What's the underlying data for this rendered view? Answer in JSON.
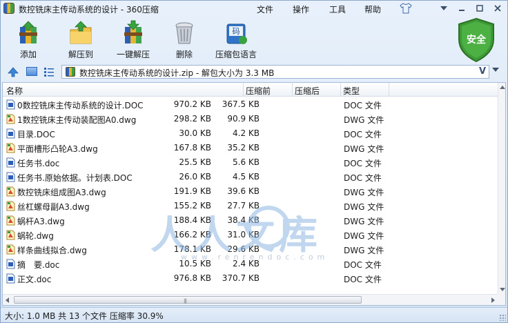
{
  "window": {
    "title": "数控铣床主传动系统的设计 - 360压缩"
  },
  "menu": {
    "file": "文件",
    "operation": "操作",
    "tools": "工具",
    "help": "帮助"
  },
  "toolbar": {
    "add": "添加",
    "extract_to": "解压到",
    "one_click_extract": "一键解压",
    "delete": "删除",
    "archive_info": "压缩包语言"
  },
  "security_badge": "安全",
  "address": {
    "path": "数控铣床主传动系统的设计.zip - 解包大小为 3.3 MB",
    "dropdown_glyph": "V"
  },
  "columns": {
    "name": "名称",
    "original": "压缩前",
    "compressed": "压缩后",
    "type": "类型"
  },
  "files": [
    {
      "name": "0数控铣床主传动系统的设计.DOC",
      "original": "970.2 KB",
      "compressed": "367.5 KB",
      "type": "DOC 文件",
      "kind": "doc"
    },
    {
      "name": "1数控铣床主传动装配图A0.dwg",
      "original": "298.2 KB",
      "compressed": "90.9 KB",
      "type": "DWG 文件",
      "kind": "dwg"
    },
    {
      "name": "目录.DOC",
      "original": "30.0 KB",
      "compressed": "4.2 KB",
      "type": "DOC 文件",
      "kind": "doc"
    },
    {
      "name": "平面槽形凸轮A3.dwg",
      "original": "167.8 KB",
      "compressed": "35.2 KB",
      "type": "DWG 文件",
      "kind": "dwg"
    },
    {
      "name": "任务书.doc",
      "original": "25.5 KB",
      "compressed": "5.6 KB",
      "type": "DOC 文件",
      "kind": "doc"
    },
    {
      "name": "任务书.原始依据。计划表.DOC",
      "original": "26.0 KB",
      "compressed": "4.5 KB",
      "type": "DOC 文件",
      "kind": "doc"
    },
    {
      "name": "数控铣床组成图A3.dwg",
      "original": "191.9 KB",
      "compressed": "39.6 KB",
      "type": "DWG 文件",
      "kind": "dwg"
    },
    {
      "name": "丝杠螺母副A3.dwg",
      "original": "155.2 KB",
      "compressed": "27.7 KB",
      "type": "DWG 文件",
      "kind": "dwg"
    },
    {
      "name": "蜗杆A3.dwg",
      "original": "188.4 KB",
      "compressed": "38.4 KB",
      "type": "DWG 文件",
      "kind": "dwg"
    },
    {
      "name": "蜗轮.dwg",
      "original": "166.2 KB",
      "compressed": "31.0 KB",
      "type": "DWG 文件",
      "kind": "dwg"
    },
    {
      "name": "样条曲线拟合.dwg",
      "original": "178.1 KB",
      "compressed": "29.6 KB",
      "type": "DWG 文件",
      "kind": "dwg"
    },
    {
      "name": "摘　要.doc",
      "original": "10.5 KB",
      "compressed": "2.4 KB",
      "type": "DOC 文件",
      "kind": "doc"
    },
    {
      "name": "正文.doc",
      "original": "976.8 KB",
      "compressed": "370.7 KB",
      "type": "DOC 文件",
      "kind": "doc"
    }
  ],
  "watermark": {
    "text": "人人文库",
    "url": "www.renrendoc.com"
  },
  "status": "大小: 1.0 MB 共 13 个文件 压缩率 30.9%"
}
